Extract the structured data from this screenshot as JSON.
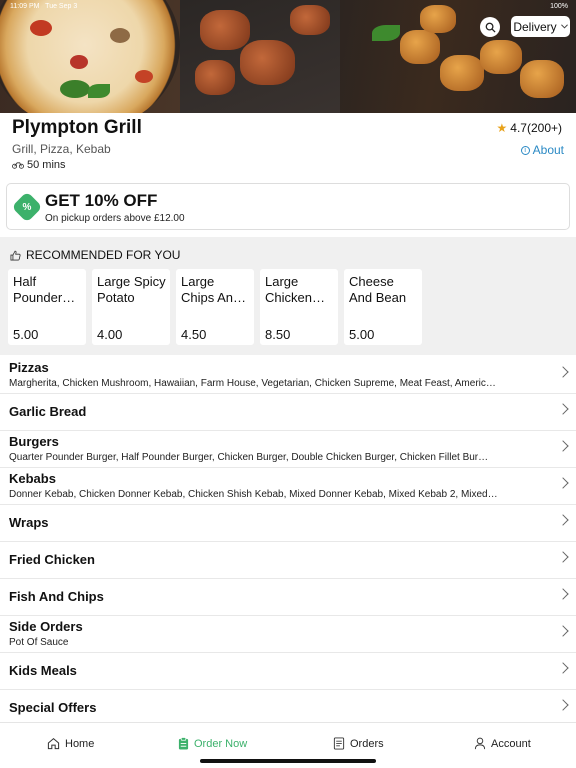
{
  "status_bar": {
    "time": "11:09 PM",
    "date": "Tue Sep 3",
    "battery": "100%"
  },
  "header": {
    "delivery_label": "Delivery"
  },
  "restaurant": {
    "name": "Plympton Grill",
    "rating": "4.7(200+)",
    "cuisine": "Grill, Pizza, Kebab",
    "eta": "50 mins",
    "about_label": "About"
  },
  "offer": {
    "badge": "%",
    "title": "GET 10% OFF",
    "subtitle": "On pickup orders above £12.00"
  },
  "recommended": {
    "title": "RECOMMENDED FOR YOU",
    "items": [
      {
        "name": "Half Pounder Burger",
        "price": "5.00"
      },
      {
        "name": "Large Spicy Potato",
        "price": "4.00"
      },
      {
        "name": "Large Chips And Cheese",
        "price": "4.50"
      },
      {
        "name": "Large Chicken Shish",
        "price": "8.50"
      },
      {
        "name": "Cheese And Bean",
        "price": "5.00"
      }
    ]
  },
  "categories": [
    {
      "name": "Pizzas",
      "desc": "Margherita, Chicken Mushroom, Hawaiian, Farm House, Vegetarian, Chicken Supreme, Meat Feast, Americ…"
    },
    {
      "name": "Garlic Bread",
      "desc": ""
    },
    {
      "name": "Burgers",
      "desc": "Quarter Pounder  Burger, Half Pounder Burger, Chicken Burger, Double Chicken Burger, Chicken Fillet Bur…"
    },
    {
      "name": "Kebabs",
      "desc": "Donner Kebab, Chicken Donner Kebab, Chicken Shish Kebab, Mixed Donner Kebab, Mixed Kebab 2, Mixed…"
    },
    {
      "name": "Wraps",
      "desc": ""
    },
    {
      "name": "Fried Chicken",
      "desc": ""
    },
    {
      "name": "Fish And Chips",
      "desc": ""
    },
    {
      "name": "Side Orders",
      "desc": "Pot Of Sauce"
    },
    {
      "name": "Kids Meals",
      "desc": ""
    },
    {
      "name": "Special Offers",
      "desc": ""
    }
  ],
  "tabs": [
    {
      "label": "Home",
      "icon": "home-icon"
    },
    {
      "label": "Order Now",
      "icon": "order-icon"
    },
    {
      "label": "Orders",
      "icon": "receipt-icon"
    },
    {
      "label": "Account",
      "icon": "user-icon"
    }
  ],
  "colors": {
    "accent": "#3cb16b",
    "link": "#2a89c4",
    "star": "#e8a21a"
  }
}
